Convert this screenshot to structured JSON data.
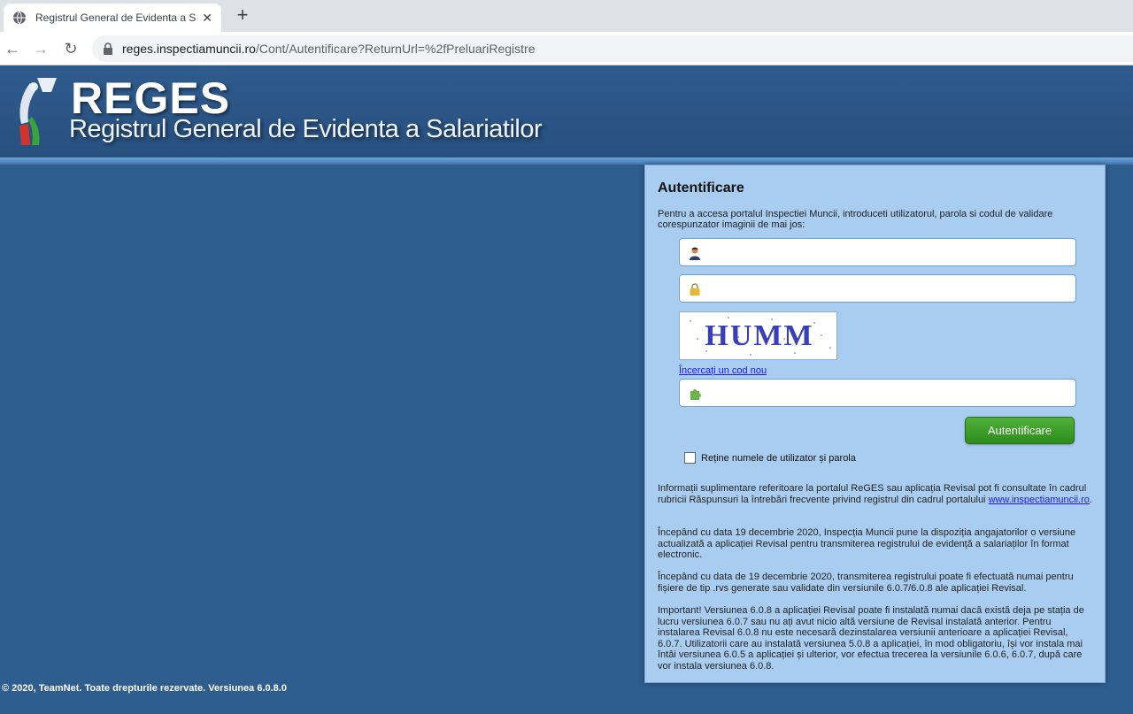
{
  "browser": {
    "tab_title": "Registrul General de Evidenta a S",
    "url_host": "reges.inspectiamuncii.ro",
    "url_path": "/Cont/Autentificare?ReturnUrl=%2fPreluariRegistre"
  },
  "header": {
    "brand": "REGES",
    "subtitle": "Registrul General de Evidenta a Salariatilor"
  },
  "login": {
    "title": "Autentificare",
    "intro": "Pentru a accesa portalul Inspectiei Muncii, introduceti utilizatorul, parola si codul de validare corespunzator imaginii de mai jos:",
    "username_value": "",
    "password_value": "",
    "captcha_text": "HUMM",
    "new_code_link": "Încercați un cod nou",
    "captcha_value": "",
    "submit_label": "Autentificare",
    "remember_label": "Reține numele de utilizator și parola",
    "remember_checked": false
  },
  "info": {
    "p1_text": "Informații suplimentare referitoare la portalul ReGES sau aplicația Revisal pot fi consultate în cadrul rubricii Răspunsuri la întrebări frecvente privind registrul din cadrul portalului",
    "p1_link": "www.inspectiamuncii.ro",
    "p2": "Începând cu data 19 decembrie 2020, Inspecția Muncii pune la dispoziția angajatorilor o versiune actualizată a aplicației Revisal pentru transmiterea registrului de evidență a salariaților în format electronic.",
    "p3": "Începând cu data de 19 decembrie 2020, transmiterea registrului poate fi efectuată numai pentru fișiere de tip .rvs generate sau validate din versiunile 6.0.7/6.0.8 ale aplicației Revisal.",
    "p4": "Important! Versiunea 6.0.8 a aplicației Revisal poate fi instalată numai dacă există deja pe stația de lucru versiunea 6.0.7 sau nu ați avut nicio altă versiune de Revisal instalată anterior. Pentru instalarea Revisal 6.0.8 nu este necesară dezinstalarea versiunii anterioare a aplicației Revisal, 6.0.7. Utilizatorii care au instalată versiunea 5.0.8 a aplicației, în mod obligatoriu, își vor instala mai întâi versiunea 6.0.5 a aplicației și ulterior, vor efectua trecerea la versiunile 6.0.6, 6.0.7, după care vor instala versiunea 6.0.8."
  },
  "footer": {
    "text": "© 2020, TeamNet. Toate drepturile rezervate. Versiunea 6.0.8.0"
  },
  "colors": {
    "page_bg": "#2e5d8e",
    "panel_bg": "#a9cdf0",
    "button_green": "#2d8d1c",
    "link_blue": "#1a1aee"
  }
}
